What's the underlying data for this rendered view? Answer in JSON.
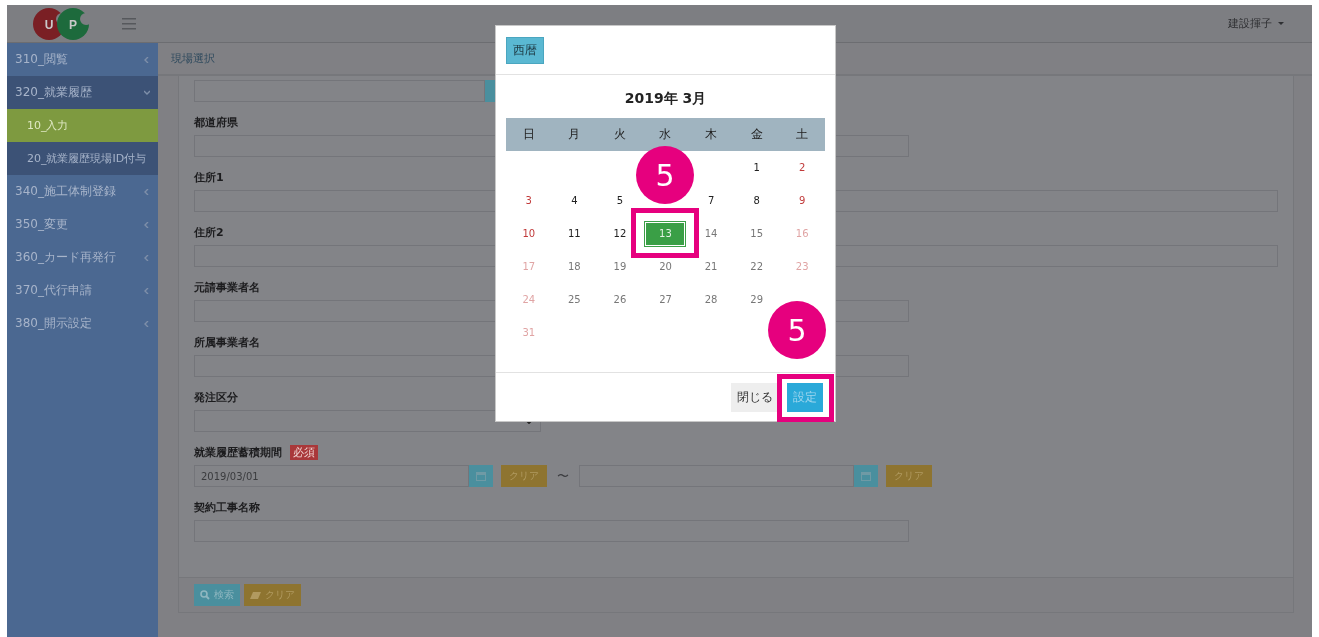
{
  "header": {
    "logo_letters": [
      "U",
      "P"
    ],
    "user_menu": "建設揮子"
  },
  "sidebar": {
    "items": [
      {
        "label": "310_閲覧",
        "expanded": false
      },
      {
        "label": "320_就業履歴",
        "expanded": true,
        "children": [
          {
            "label": "10_入力",
            "selected": true
          },
          {
            "label": "20_就業履歴現場ID付与",
            "selected": false
          }
        ]
      },
      {
        "label": "340_施工体制登録",
        "expanded": false
      },
      {
        "label": "350_変更",
        "expanded": false
      },
      {
        "label": "360_カード再発行",
        "expanded": false
      },
      {
        "label": "370_代行申請",
        "expanded": false
      },
      {
        "label": "380_開示設定",
        "expanded": false
      }
    ]
  },
  "breadcrumb": "現場選択",
  "form": {
    "fields": [
      {
        "kind": "text",
        "label": "都道府県"
      },
      {
        "kind": "text",
        "label": "住所1"
      },
      {
        "kind": "text",
        "label": "住所2"
      },
      {
        "kind": "text",
        "label": "元請事業者名"
      },
      {
        "kind": "text",
        "label": "所属事業者名"
      },
      {
        "kind": "select",
        "label": "発注区分"
      },
      {
        "kind": "period",
        "label": "就業履歴蓄積期間",
        "required": "必須",
        "from": "2019/03/01",
        "clear": "クリア",
        "separator": "〜",
        "to_clear": "クリア"
      },
      {
        "kind": "text",
        "label": "契約工事名称"
      }
    ],
    "buttons": [
      {
        "kind": "search",
        "label": "検索"
      },
      {
        "kind": "clear",
        "label": "クリア"
      }
    ]
  },
  "date_picker": {
    "era_button": "西暦",
    "title": "2019年 3月",
    "weekdays": [
      "日",
      "月",
      "火",
      "水",
      "木",
      "金",
      "土"
    ],
    "days": [
      {
        "kind": "blank"
      },
      {
        "kind": "blank"
      },
      {
        "kind": "blank"
      },
      {
        "kind": "blank"
      },
      {
        "kind": "blank"
      },
      {
        "kind": "weekday",
        "label": "1",
        "disabled": false,
        "selected": false
      },
      {
        "kind": "weekend",
        "label": "2",
        "disabled": false,
        "selected": false
      },
      {
        "kind": "weekend",
        "label": "3",
        "disabled": false,
        "selected": false
      },
      {
        "kind": "weekday",
        "label": "4",
        "disabled": false,
        "selected": false
      },
      {
        "kind": "weekday",
        "label": "5",
        "disabled": false,
        "selected": false
      },
      {
        "kind": "blank"
      },
      {
        "kind": "weekday",
        "label": "7",
        "disabled": false,
        "selected": false
      },
      {
        "kind": "weekday",
        "label": "8",
        "disabled": false,
        "selected": false
      },
      {
        "kind": "weekend",
        "label": "9",
        "disabled": false,
        "selected": false
      },
      {
        "kind": "weekend",
        "label": "10",
        "disabled": false,
        "selected": false
      },
      {
        "kind": "weekday",
        "label": "11",
        "disabled": false,
        "selected": false
      },
      {
        "kind": "weekday",
        "label": "12",
        "disabled": false,
        "selected": false
      },
      {
        "kind": "weekday",
        "label": "13",
        "disabled": false,
        "selected": true
      },
      {
        "kind": "weekday",
        "label": "14",
        "disabled": true,
        "selected": false
      },
      {
        "kind": "weekday",
        "label": "15",
        "disabled": true,
        "selected": false
      },
      {
        "kind": "weekend",
        "label": "16",
        "disabled": true,
        "selected": false
      },
      {
        "kind": "weekend",
        "label": "17",
        "disabled": true,
        "selected": false
      },
      {
        "kind": "weekday",
        "label": "18",
        "disabled": true,
        "selected": false
      },
      {
        "kind": "weekday",
        "label": "19",
        "disabled": true,
        "selected": false
      },
      {
        "kind": "weekday",
        "label": "20",
        "disabled": true,
        "selected": false
      },
      {
        "kind": "weekday",
        "label": "21",
        "disabled": true,
        "selected": false
      },
      {
        "kind": "weekday",
        "label": "22",
        "disabled": true,
        "selected": false
      },
      {
        "kind": "weekend",
        "label": "23",
        "disabled": true,
        "selected": false
      },
      {
        "kind": "weekend",
        "label": "24",
        "disabled": true,
        "selected": false
      },
      {
        "kind": "weekday",
        "label": "25",
        "disabled": true,
        "selected": false
      },
      {
        "kind": "weekday",
        "label": "26",
        "disabled": true,
        "selected": false
      },
      {
        "kind": "weekday",
        "label": "27",
        "disabled": true,
        "selected": false
      },
      {
        "kind": "weekday",
        "label": "28",
        "disabled": true,
        "selected": false
      },
      {
        "kind": "weekday",
        "label": "29",
        "disabled": true,
        "selected": false
      },
      {
        "kind": "blank"
      },
      {
        "kind": "weekend",
        "label": "31",
        "disabled": true,
        "selected": false
      }
    ],
    "buttons": [
      {
        "kind": "close",
        "label": "閉じる"
      },
      {
        "kind": "set",
        "label": "設定"
      }
    ]
  },
  "annotations": [
    {
      "kind": "step",
      "label": "5"
    },
    {
      "kind": "step",
      "label": "5"
    }
  ]
}
